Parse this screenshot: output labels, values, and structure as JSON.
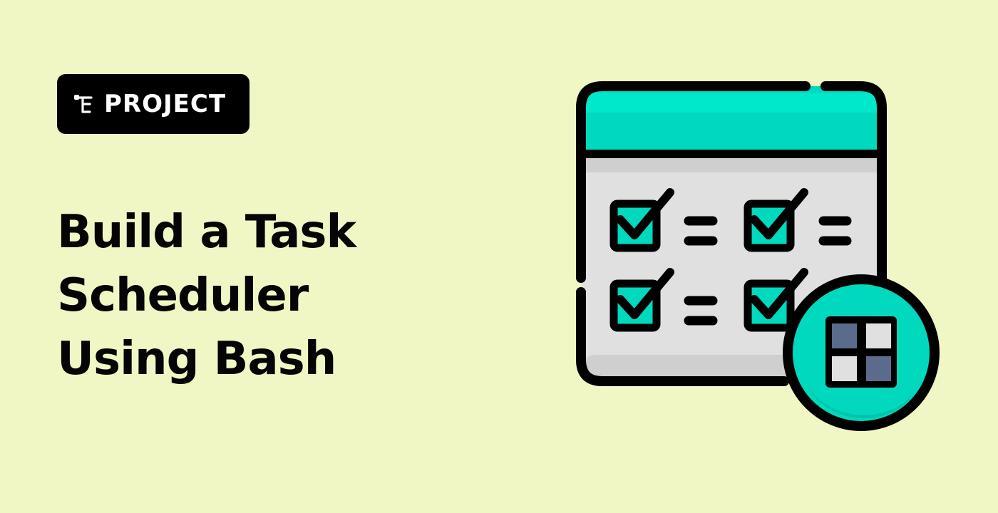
{
  "badge": {
    "label": "PROJECT",
    "icon": "project-tree-icon"
  },
  "title": {
    "line1": "Build a Task",
    "line2": "Scheduler",
    "line3": "Using Bash"
  },
  "illustration": {
    "icon": "task-calendar-checklist-icon",
    "badge_icon": "grid-icon"
  },
  "colors": {
    "background": "#f1f7c4",
    "badge_background": "#000000",
    "accent": "#00d9bd",
    "panel": "#e0e0e0",
    "grid_dark": "#5a6b8c",
    "outline": "#000000"
  }
}
